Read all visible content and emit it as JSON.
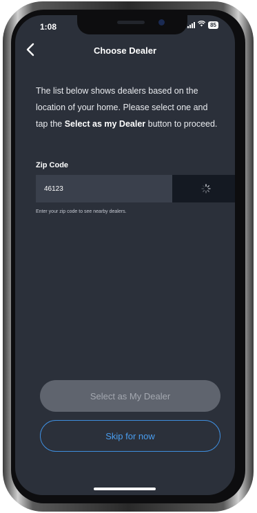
{
  "status_bar": {
    "time": "1:08",
    "battery": "85",
    "icons": [
      "signal-icon",
      "wifi-icon",
      "battery-icon"
    ]
  },
  "nav": {
    "title": "Choose Dealer",
    "back_icon": "chevron-left-icon"
  },
  "intro": {
    "text_before": "The list below shows dealers based on the location of your home. Please select one and tap the ",
    "bold": "Select as my Dealer",
    "text_after": " button to proceed."
  },
  "zip": {
    "label": "Zip Code",
    "value": "46123",
    "helper": "Enter your zip code to see nearby dealers.",
    "search_icon": "loading-spinner-icon"
  },
  "buttons": {
    "select_dealer": "Select as My Dealer",
    "skip": "Skip for now"
  },
  "colors": {
    "screen_bg": "#2b303a",
    "input_bg": "#3a404c",
    "search_button_bg": "#141922",
    "disabled_button_bg": "#5f646e",
    "accent_blue": "#3f8fe0"
  }
}
